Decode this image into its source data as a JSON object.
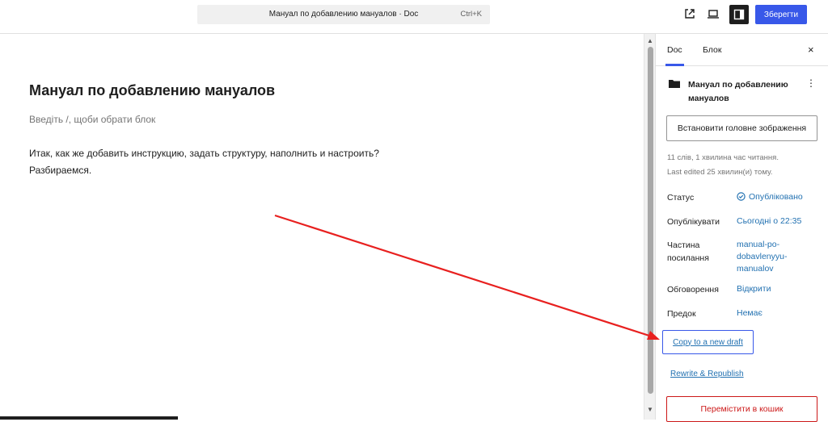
{
  "header": {
    "doc_title": "Мануал по добавлению мануалов · Doc",
    "shortcut": "Ctrl+K",
    "save_label": "Зберегти",
    "icons": [
      "external-link-icon",
      "preview-icon",
      "sidebar-toggle-icon"
    ]
  },
  "editor": {
    "title": "Мануал по добавлению мануалов",
    "placeholder": "Введіть /, щоби обрати блок",
    "paragraph_line1": "Итак, как же добавить инструкцию, задать структуру, наполнить и настроить?",
    "paragraph_line2": "Разбираемся."
  },
  "sidebar": {
    "tabs": [
      {
        "label": "Doc",
        "active": true
      },
      {
        "label": "Блок",
        "active": false
      }
    ],
    "close_label": "×",
    "doc_title": "Мануал по добавлению мануалов",
    "featured_image_label": "Встановити головне зображення",
    "words_info": "11 слів, 1 хвилина час читання.",
    "edited_info": "Last edited 25 хвилин(и) тому.",
    "rows": [
      {
        "label": "Статус",
        "value": "Опубліковано"
      },
      {
        "label": "Опублікувати",
        "value": "Сьогодні о 22:35"
      },
      {
        "label_line1": "Частина",
        "label_line2": "посилання",
        "value_line1": "manual-po-",
        "value_line2": "dobavlenyyu-",
        "value_line3": "manualov"
      },
      {
        "label": "Обговорення",
        "value": "Відкрити"
      },
      {
        "label": "Предок",
        "value": "Немає"
      }
    ],
    "copy_draft_label": "Copy to a new draft",
    "rewrite_label": "Rewrite & Republish",
    "trash_label": "Перемістити в кошик"
  },
  "colors": {
    "accent": "#3858e9",
    "link": "#2271b1",
    "danger": "#cc1818",
    "annotation_arrow": "#e8201f"
  }
}
